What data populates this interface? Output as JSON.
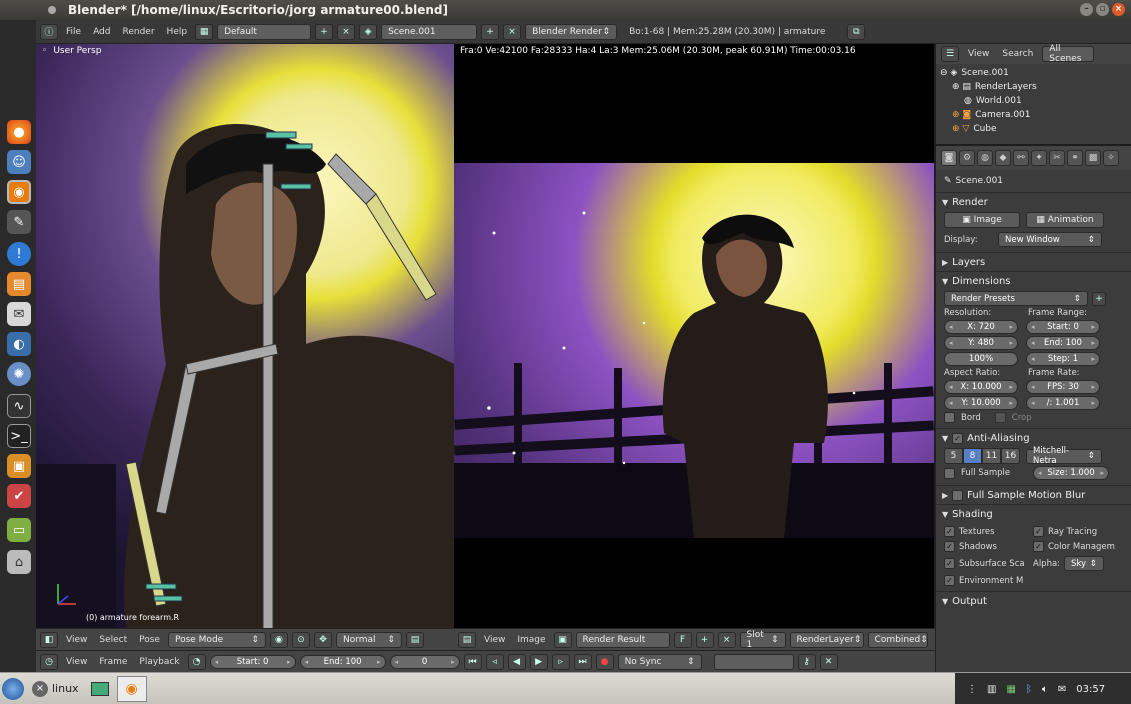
{
  "window": {
    "title": "Blender* [/home/linux/Escritorio/jorg armature00.blend]",
    "controls": [
      "–",
      "▫",
      "×"
    ]
  },
  "launcher": {
    "icons": [
      "firefox-icon",
      "users-icon",
      "blender-icon",
      "gimp-icon",
      "help-icon",
      "software-center-icon",
      "mail-icon",
      "people-icon",
      "settings-icon",
      "monitor-icon",
      "terminal-icon",
      "archive-icon",
      "tools-icon",
      "folder-icon",
      "trash-icon"
    ]
  },
  "topbar": {
    "menus": [
      "File",
      "Add",
      "Render",
      "Help"
    ],
    "screen_layout": "Default",
    "scene": "Scene.001",
    "engine": "Blender Render",
    "stats": "Bo:1-68  | Mem:25.28M (20.30M) | armature"
  },
  "viewport": {
    "view_label": "User Persp",
    "object_label": "(0) armature forearm.R",
    "menus": [
      "View",
      "Select",
      "Pose"
    ],
    "mode": "Pose Mode",
    "orientation": "Normal"
  },
  "render": {
    "info": "Fra:0  Ve:42100 Fa:28333 Ha:4 La:3 Mem:25.06M (20.30M, peak 60.91M) Time:00:03.16",
    "menus": [
      "View",
      "Image"
    ],
    "image_name": "Render Result",
    "fake_user": "F",
    "slot": "Slot 1",
    "layer": "RenderLayer",
    "pass": "Combined"
  },
  "timeline": {
    "menus": [
      "View",
      "Frame",
      "Playback"
    ],
    "start": "Start: 0",
    "end": "End: 100",
    "current": "0",
    "sync": "No Sync"
  },
  "outliner": {
    "menus": [
      "View",
      "Search"
    ],
    "filter": "All Scenes",
    "items": [
      "Scene.001",
      "RenderLayers",
      "World.001",
      "Camera.001",
      "Cube"
    ]
  },
  "properties": {
    "scene": "Scene.001",
    "render_panel": "Render",
    "image_button": "Image",
    "animation_button": "Animation",
    "display_label": "Display:",
    "display_value": "New Window",
    "layers_panel": "Layers",
    "dimensions_panel": "Dimensions",
    "render_presets": "Render Presets",
    "resolution_label": "Resolution:",
    "res_x": "X: 720",
    "res_y": "Y: 480",
    "res_pct": "100%",
    "frame_range_label": "Frame Range:",
    "frame_start": "Start: 0",
    "frame_end": "End: 100",
    "frame_step": "Step: 1",
    "aspect_label": "Aspect Ratio:",
    "aspect_x": "X: 10.000",
    "aspect_y": "Y: 10.000",
    "frame_rate_label": "Frame Rate:",
    "fps": "FPS: 30",
    "fps_base": "/: 1.001",
    "bord": "Bord",
    "crop": "Crop",
    "aa_panel": "Anti-Aliasing",
    "aa_samples": [
      "5",
      "8",
      "11",
      "16"
    ],
    "aa_filter": "Mitchell-Netra",
    "full_sample": "Full Sample",
    "aa_size": "Size: 1.000",
    "motion_blur_panel": "Full Sample Motion Blur",
    "shading_panel": "Shading",
    "textures": "Textures",
    "ray_tracing": "Ray Tracing",
    "shadows": "Shadows",
    "color_management": "Color Managem",
    "subsurface": "Subsurface Sca",
    "alpha_label": "Alpha:",
    "alpha_value": "Sky",
    "environment": "Environment M",
    "output_panel": "Output"
  },
  "taskbar": {
    "user": "linux",
    "clock": "03:57"
  }
}
